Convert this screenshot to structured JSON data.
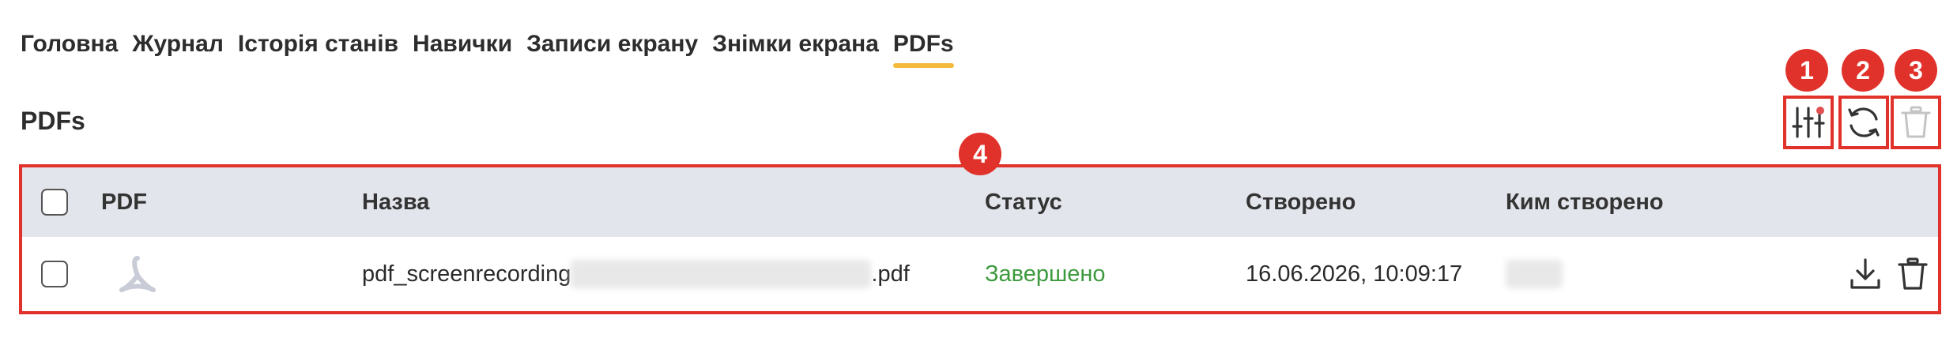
{
  "tabs": [
    {
      "label": "Головна"
    },
    {
      "label": "Журнал"
    },
    {
      "label": "Історія станів"
    },
    {
      "label": "Навички"
    },
    {
      "label": "Записи екрану"
    },
    {
      "label": "Знімки екрана"
    },
    {
      "label": "PDFs",
      "active": true
    }
  ],
  "section": {
    "title": "PDFs"
  },
  "toolbar": {
    "filter_icon": "sliders-icon",
    "refresh_icon": "refresh-icon",
    "delete_icon": "trash-icon"
  },
  "badges": [
    "1",
    "2",
    "3",
    "4"
  ],
  "table": {
    "columns": [
      "PDF",
      "Назва",
      "Статус",
      "Створено",
      "Ким створено"
    ],
    "rows": [
      {
        "name_prefix": "pdf_screenrecording",
        "name_suffix": ".pdf",
        "status": "Завершено",
        "created": "16.06.2026, 10:09:17"
      }
    ]
  },
  "colors": {
    "accent": "#f2b93a",
    "highlight": "#e0322a",
    "status_done": "#3d9a3d"
  }
}
